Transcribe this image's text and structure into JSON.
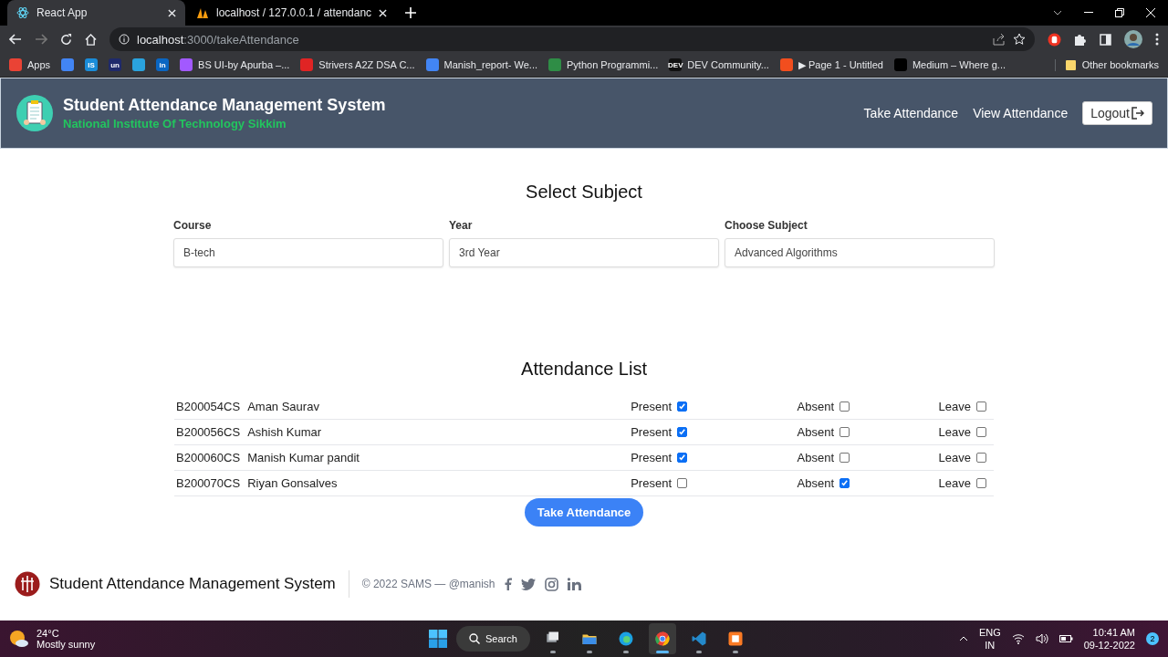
{
  "browser": {
    "tabs": [
      {
        "title": "React App",
        "selected": true
      },
      {
        "title": "localhost / 127.0.0.1 / attendanc",
        "selected": false
      }
    ],
    "url": {
      "host": "localhost",
      "path": ":3000/takeAttendance"
    },
    "bookmarks": [
      {
        "label": "Apps",
        "color": "#ea4335"
      },
      {
        "color": "#4285f4"
      },
      {
        "icon_text": "IS",
        "color": "#1a8cd8"
      },
      {
        "icon_text": "un",
        "color": "#1f2a6b"
      },
      {
        "color": "#2aa3de"
      },
      {
        "icon_text": "in",
        "color": "#0a66c2"
      },
      {
        "label": "BS UI-by Apurba –...",
        "color": "#a259ff"
      },
      {
        "label": "Strivers A2Z DSA C...",
        "color": "#e02424"
      },
      {
        "label": "Manish_report- We...",
        "color": "#4285f4"
      },
      {
        "label": "Python Programmi...",
        "color": "#2f8d46"
      },
      {
        "icon_text": "DEV",
        "label": "DEV Community...",
        "color": "#111111"
      },
      {
        "label": "▶ Page 1 - Untitled",
        "color": "#f24e1e"
      },
      {
        "label": "Medium – Where g...",
        "color": "#000000"
      }
    ],
    "other_bookmarks": "Other bookmarks"
  },
  "header": {
    "title": "Student Attendance Management System",
    "subtitle": "National Institute Of Technology Sikkim",
    "nav": [
      "Take Attendance",
      "View Attendance"
    ],
    "logout": "Logout"
  },
  "subject": {
    "heading": "Select Subject",
    "fields": [
      {
        "label": "Course",
        "value": "B-tech"
      },
      {
        "label": "Year",
        "value": "3rd Year"
      },
      {
        "label": "Choose Subject",
        "value": "Advanced Algorithms"
      }
    ]
  },
  "attendance": {
    "heading": "Attendance List",
    "rows": [
      {
        "roll": "B200054CS",
        "name": "Aman Saurav",
        "options": [
          {
            "label": "Present",
            "checked": true
          },
          {
            "label": "Absent",
            "checked": false
          },
          {
            "label": "Leave",
            "checked": false
          }
        ]
      },
      {
        "roll": "B200056CS",
        "name": "Ashish Kumar",
        "options": [
          {
            "label": "Present",
            "checked": true
          },
          {
            "label": "Absent",
            "checked": false
          },
          {
            "label": "Leave",
            "checked": false
          }
        ]
      },
      {
        "roll": "B200060CS",
        "name": "Manish Kumar pandit",
        "options": [
          {
            "label": "Present",
            "checked": true
          },
          {
            "label": "Absent",
            "checked": false
          },
          {
            "label": "Leave",
            "checked": false
          }
        ]
      },
      {
        "roll": "B200070CS",
        "name": "Riyan Gonsalves",
        "options": [
          {
            "label": "Present",
            "checked": false
          },
          {
            "label": "Absent",
            "checked": true
          },
          {
            "label": "Leave",
            "checked": false
          }
        ]
      }
    ],
    "submit": "Take Attendance"
  },
  "footer": {
    "title": "Student Attendance Management System",
    "copyright": "© 2022 SAMS — @manish"
  },
  "taskbar": {
    "temperature": "24°C",
    "weather": "Mostly sunny",
    "search": "Search",
    "apps": [
      {
        "selected": false
      },
      {
        "selected": false
      },
      {
        "selected": false
      },
      {
        "selected": true
      },
      {
        "selected": false
      },
      {
        "selected": false
      }
    ],
    "language": [
      "ENG",
      "IN"
    ],
    "time": "10:41 AM",
    "date": "09-12-2022",
    "notifications": "2"
  }
}
